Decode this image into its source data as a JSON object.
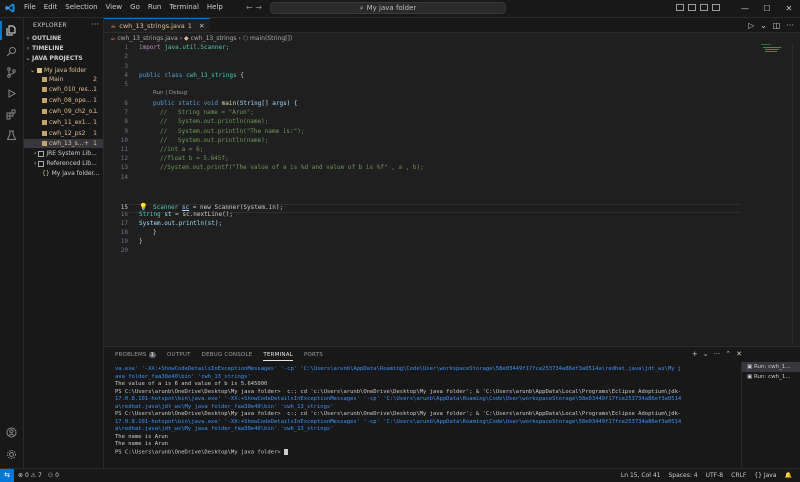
{
  "titlebar": {
    "menu": [
      "File",
      "Edit",
      "Selection",
      "View",
      "Go",
      "Run",
      "Terminal",
      "Help"
    ],
    "command_center": "My java folder"
  },
  "sidebar": {
    "title": "EXPLORER",
    "sections": {
      "outline": "OUTLINE",
      "timeline": "TIMELINE",
      "java_projects": "JAVA PROJECTS"
    },
    "tree": [
      {
        "label": "My java folder",
        "badge": ""
      },
      {
        "label": "Main",
        "badge": "2"
      },
      {
        "label": "cwh_010_res...",
        "badge": "1"
      },
      {
        "label": "cwh_08_ope...",
        "badge": "1"
      },
      {
        "label": "cwh_09_ch2_o...",
        "badge": "1"
      },
      {
        "label": "cwh_11_ex1...",
        "badge": "1"
      },
      {
        "label": "cwh_12_ps2",
        "badge": "1"
      },
      {
        "label": "cwh_13_s...",
        "badge": "1"
      },
      {
        "label": "JRE System Lib...",
        "badge": ""
      },
      {
        "label": "Referenced Lib...",
        "badge": ""
      },
      {
        "label": "My java folder...",
        "badge": ""
      }
    ]
  },
  "editor": {
    "tab_label": "cwh_13_strings.java",
    "tab_badge": "1",
    "breadcrumb": [
      "cwh_13_strings.java",
      "cwh_13_strings",
      "main(String[])"
    ],
    "codelens": "Run | Debug",
    "lines": [
      {
        "n": "1"
      },
      {
        "n": "2"
      },
      {
        "n": "3"
      },
      {
        "n": "4"
      },
      {
        "n": "5"
      },
      {
        "n": "6"
      },
      {
        "n": "7"
      },
      {
        "n": "8"
      },
      {
        "n": "9"
      },
      {
        "n": "10"
      },
      {
        "n": "11"
      },
      {
        "n": "12"
      },
      {
        "n": "13"
      },
      {
        "n": "14"
      },
      {
        "n": "15"
      },
      {
        "n": "16"
      },
      {
        "n": "17"
      },
      {
        "n": "18"
      },
      {
        "n": "19"
      },
      {
        "n": "20"
      }
    ],
    "code": {
      "l1_import": "import",
      "l1_pkg": "java.util.Scanner;",
      "l4_public": "public",
      "l4_class": "class",
      "l4_name": "cwh_13_strings",
      "l4_brace": "{",
      "l6_mods": "public static void",
      "l6_main": "main",
      "l6_args": "(String[] args) {",
      "l7": "//   String name = \"Arun\";",
      "l8": "//   System.out.println(name);",
      "l9": "//   System.out.println(\"The name is:\");",
      "l10": "//   System.out.println(name);",
      "l11": "//int a = 6;",
      "l12": "//float b = 5.645f;",
      "l13": "//System.out.printf(\"The value of a is %d and value of b is %f\" , a , b);",
      "l15_type": "Scanner",
      "l15_var": "sc",
      "l15_rest": "= new Scanner(System.in);",
      "l16_type": "String",
      "l16_var": "st",
      "l16_rest": "= sc.nextLine();",
      "l17": "System.out.println(st);",
      "l18": "}",
      "l19": "}"
    }
  },
  "panel": {
    "tabs": [
      "PROBLEMS",
      "OUTPUT",
      "DEBUG CONSOLE",
      "TERMINAL",
      "PORTS"
    ],
    "problems_count": "1",
    "terminal_lines": [
      "va.exe' '-XX:+ShowCodeDetailsInExceptionMessages' '-cp' 'C:\\Users\\arunb\\AppData\\Roaming\\Code\\User\\workspaceStorage\\58e03449f17fce253734a86ef3a0514a\\redhat.java\\jdt_ws\\My j",
      "ava folder_faa30e40\\bin' 'cwh_13_strings'",
      "The value of a is 6 and value of b is 5.645000",
      "PS C:\\Users\\arunb\\OneDrive\\Desktop\\My java folder>  c:; cd 'c:\\Users\\arunb\\OneDrive\\Desktop\\My java folder'; & 'C:\\Users\\arunb\\AppData\\Local\\Programs\\Eclipse Adoptium\\jdk-",
      "17.0.8.101-hotspot\\bin\\java.exe' '-XX:+ShowCodeDetailsInExceptionMessages' '-cp' 'C:\\Users\\arunb\\AppData\\Roaming\\Code\\User\\workspaceStorage\\58e03449f17fce253734a86ef3a0514",
      "a\\redhat.java\\jdt_ws\\My java folder_faa30e40\\bin' 'cwh_13_strings'",
      "PS C:\\Users\\arunb\\OneDrive\\Desktop\\My java folder>  c:; cd 'c:\\Users\\arunb\\OneDrive\\Desktop\\My java folder'; & 'C:\\Users\\arunb\\AppData\\Local\\Programs\\Eclipse Adoptium\\jdk-",
      "17.0.8.101-hotspot\\bin\\java.exe' '-XX:+ShowCodeDetailsInExceptionMessages' '-cp' 'C:\\Users\\arunb\\AppData\\Roaming\\Code\\User\\workspaceStorage\\58e03449f17fce253734a86ef3a0514",
      "a\\redhat.java\\jdt_ws\\My java folder_faa30e40\\bin' 'cwh_13_strings'",
      "The name is Arun",
      "The name is Arun",
      "PS C:\\Users\\arunb\\OneDrive\\Desktop\\My java folder>"
    ],
    "terminals": [
      "Run: cwh_1...",
      "Run: cwh_1..."
    ]
  },
  "statusbar": {
    "errors": "0",
    "warnings": "7",
    "info": "0",
    "position": "Ln 15, Col 41",
    "spaces": "Spaces: 4",
    "encoding": "UTF-8",
    "eol": "CRLF",
    "language": "Java"
  },
  "colors": {
    "accent": "#0078d4",
    "modified": "#e2c08d",
    "background": "#1f1f1f"
  }
}
